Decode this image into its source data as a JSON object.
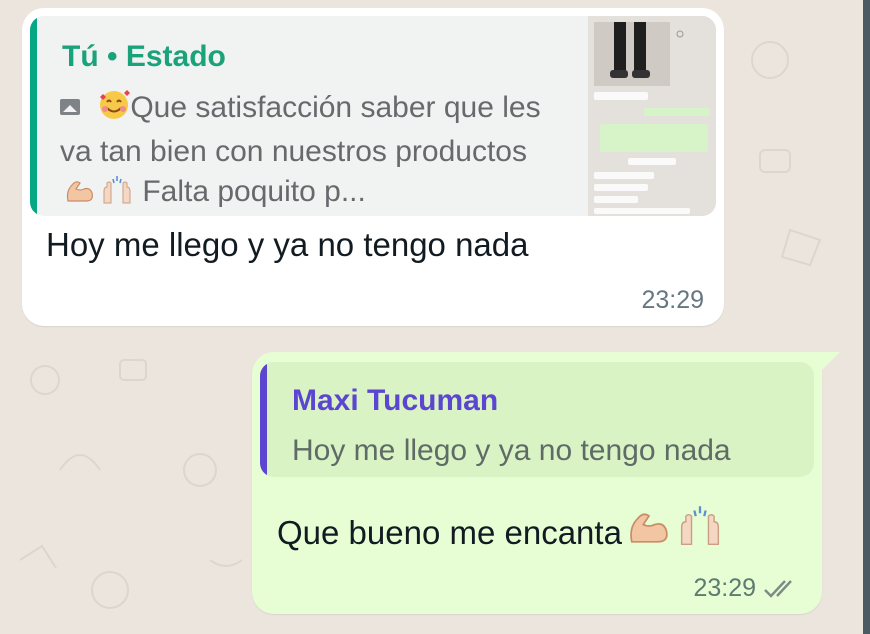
{
  "incoming": {
    "quote": {
      "author": "Tú",
      "separator": "•",
      "context": "Estado",
      "preview_text": "Que satisfacción saber que les va tan bien con nuestros productos",
      "preview_tail": "Falta poquito p...",
      "icons": [
        "photo-icon",
        "smiling-face-with-hearts-emoji",
        "flexed-biceps-emoji",
        "raising-hands-emoji"
      ]
    },
    "message": "Hoy me llego y ya no tengo nada",
    "time": "23:29"
  },
  "outgoing": {
    "quote": {
      "author": "Maxi Tucuman",
      "text": "Hoy me llego y ya no tengo nada"
    },
    "message": "Que bueno me encanta",
    "icons": [
      "flexed-biceps-emoji",
      "raising-hands-emoji"
    ],
    "time": "23:29",
    "status": "read-ticks-icon"
  },
  "colors": {
    "background": "#ebe5de",
    "incoming_bubble": "#ffffff",
    "outgoing_bubble": "#e7fdd3",
    "status_quote_bar": "#06a884",
    "status_author": "#1aa37a",
    "reply_quote_bar": "#5b45d1",
    "reply_author": "#5b45d1",
    "timestamp": "#667781"
  }
}
